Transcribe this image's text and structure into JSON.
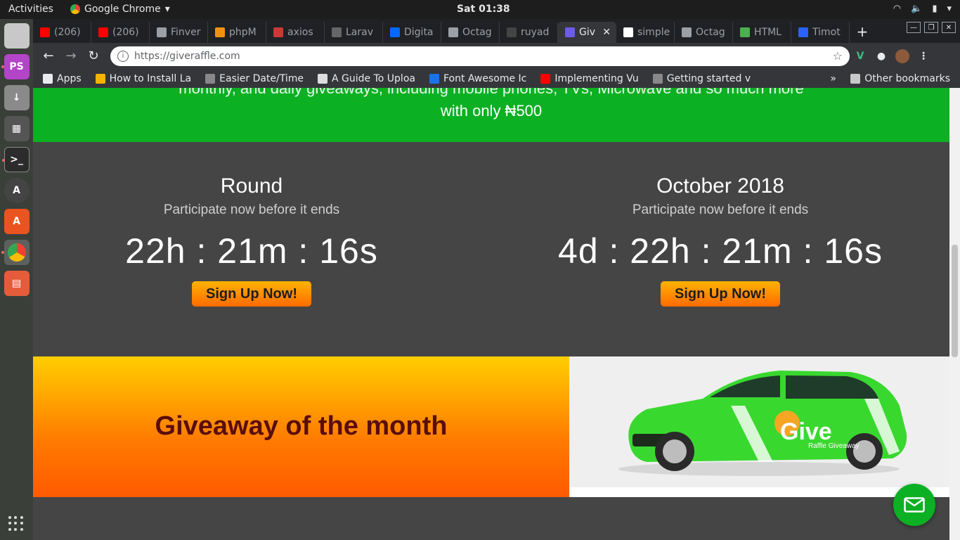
{
  "topbar": {
    "activities": "Activities",
    "app_name": "Google Chrome",
    "clock": "Sat 01:38"
  },
  "tabs": [
    {
      "label": "(206)",
      "icon": "youtube-icon",
      "color": "#ff0000"
    },
    {
      "label": "(206)",
      "icon": "youtube-icon",
      "color": "#ff0000"
    },
    {
      "label": "Finver",
      "icon": "page-icon",
      "color": "#9aa0a6"
    },
    {
      "label": "phpM",
      "icon": "phpmyadmin-icon",
      "color": "#f29111"
    },
    {
      "label": "axios",
      "icon": "npm-icon",
      "color": "#cb3837"
    },
    {
      "label": "Larav",
      "icon": "laravel-icon",
      "color": "#666666"
    },
    {
      "label": "Digita",
      "icon": "digitalocean-icon",
      "color": "#0069ff"
    },
    {
      "label": "Octag",
      "icon": "page-icon",
      "color": "#9aa0a6"
    },
    {
      "label": "ruyad",
      "icon": "github-icon",
      "color": "#444444"
    },
    {
      "label": "Giv",
      "icon": "give-icon",
      "color": "#6c5ce7",
      "active": true
    },
    {
      "label": "simple",
      "icon": "c-icon",
      "color": "#ffffff"
    },
    {
      "label": "Octag",
      "icon": "page-icon",
      "color": "#9aa0a6"
    },
    {
      "label": "HTML",
      "icon": "html-icon",
      "color": "#4caf50"
    },
    {
      "label": "Timot",
      "icon": "bootstrap-icon",
      "color": "#2962ff"
    }
  ],
  "omnibox": {
    "url": "https://giveraffle.com"
  },
  "bookmarks": [
    {
      "label": "Apps",
      "icon": "apps-grid-icon"
    },
    {
      "label": "How to Install La",
      "icon": "globe-icon"
    },
    {
      "label": "Easier Date/Time",
      "icon": "lamp-icon"
    },
    {
      "label": "A Guide To Uploa",
      "icon": "aw-icon"
    },
    {
      "label": "Font Awesome Ic",
      "icon": "flag-icon"
    },
    {
      "label": "Implementing Vu",
      "icon": "youtube-icon"
    },
    {
      "label": "Getting started v",
      "icon": "lamp-icon"
    }
  ],
  "other_bookmarks": "Other bookmarks",
  "page": {
    "banner_line1": "monthly, and daily giveaways, including mobile phones, TVs, Microwave and so much more",
    "banner_line2": "with only ₦500",
    "round": {
      "title": "Round",
      "subtitle": "Participate now before it ends",
      "timer": "22h : 21m : 16s",
      "button": "Sign Up Now!"
    },
    "month": {
      "title": "October 2018",
      "subtitle": "Participate now before it ends",
      "timer": "4d : 22h : 21m : 16s",
      "button": "Sign Up Now!"
    },
    "giveaway_heading": "Giveaway of the month",
    "car_logo_text": "Give",
    "car_logo_sub": "Raffle Giveaway"
  }
}
